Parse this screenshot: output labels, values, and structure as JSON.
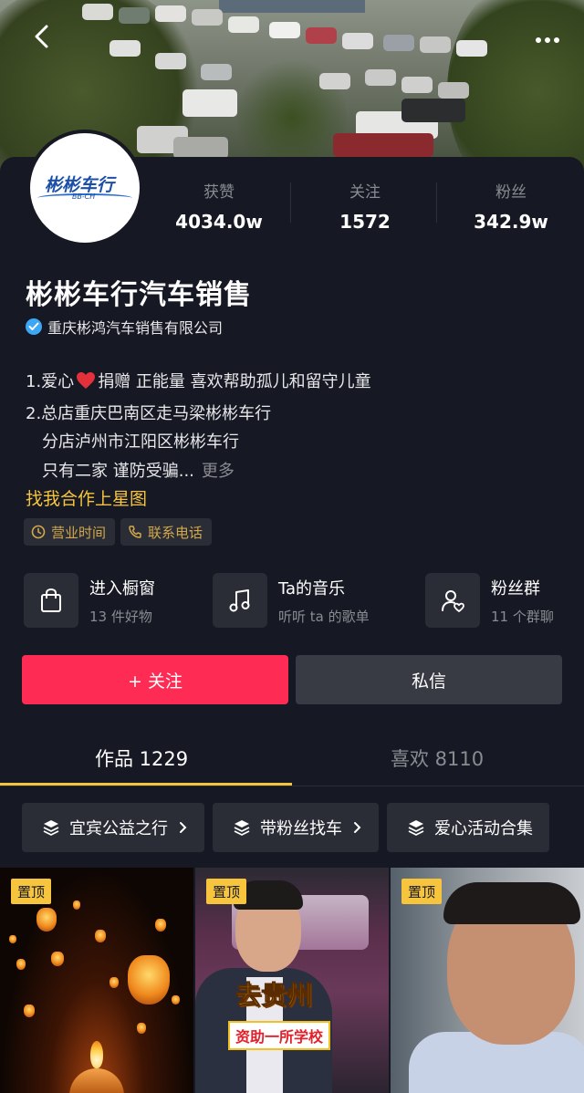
{
  "header": {
    "back_icon": "chevron-left-icon",
    "more_icon": "more-dots-icon"
  },
  "profile": {
    "avatar_logo_text": "彬彬车行",
    "avatar_logo_sub": "BB-CH",
    "name": "彬彬车行汽车销售",
    "verified_label": "重庆彬鸿汽车销售有限公司",
    "verified_color": "#3ba7f5"
  },
  "stats": [
    {
      "label": "获赞",
      "value": "4034.0w"
    },
    {
      "label": "关注",
      "value": "1572"
    },
    {
      "label": "粉丝",
      "value": "342.9w"
    }
  ],
  "bio": {
    "line1_a": "1.爱心",
    "line1_b": "捐赠  正能量  喜欢帮助孤儿和留守儿童",
    "line2": "2.总店重庆巴南区走马梁彬彬车行",
    "line3": "分店泸州市江阳区彬彬车行",
    "line4": "只有二家 谨防受骗...",
    "more": "更多"
  },
  "star_link": "找我合作上星图",
  "chips": [
    {
      "label": "营业时间",
      "icon": "clock-icon"
    },
    {
      "label": "联系电话",
      "icon": "phone-icon"
    }
  ],
  "entries": [
    {
      "title": "进入橱窗",
      "subtitle": "13 件好物",
      "icon": "shopping-bag-icon"
    },
    {
      "title": "Ta的音乐",
      "subtitle": "听听 ta 的歌单",
      "icon": "music-note-icon"
    },
    {
      "title": "粉丝群",
      "subtitle": "11 个群聊",
      "icon": "fan-group-icon"
    }
  ],
  "actions": {
    "follow": "+ 关注",
    "message": "私信",
    "follow_color": "#fe2c55"
  },
  "tabs": {
    "works": "作品 1229",
    "likes": "喜欢 8110",
    "accent": "#f6c53d"
  },
  "collections": [
    {
      "label": "宜宾公益之行",
      "icon": "layers-icon"
    },
    {
      "label": "带粉丝找车",
      "icon": "layers-icon"
    },
    {
      "label": "爱心活动合集",
      "icon": "layers-icon"
    }
  ],
  "videos": [
    {
      "pin": "置顶"
    },
    {
      "pin": "置顶",
      "caption1": "去贵州",
      "caption2": "资助一所学校"
    },
    {
      "pin": "置顶"
    }
  ]
}
